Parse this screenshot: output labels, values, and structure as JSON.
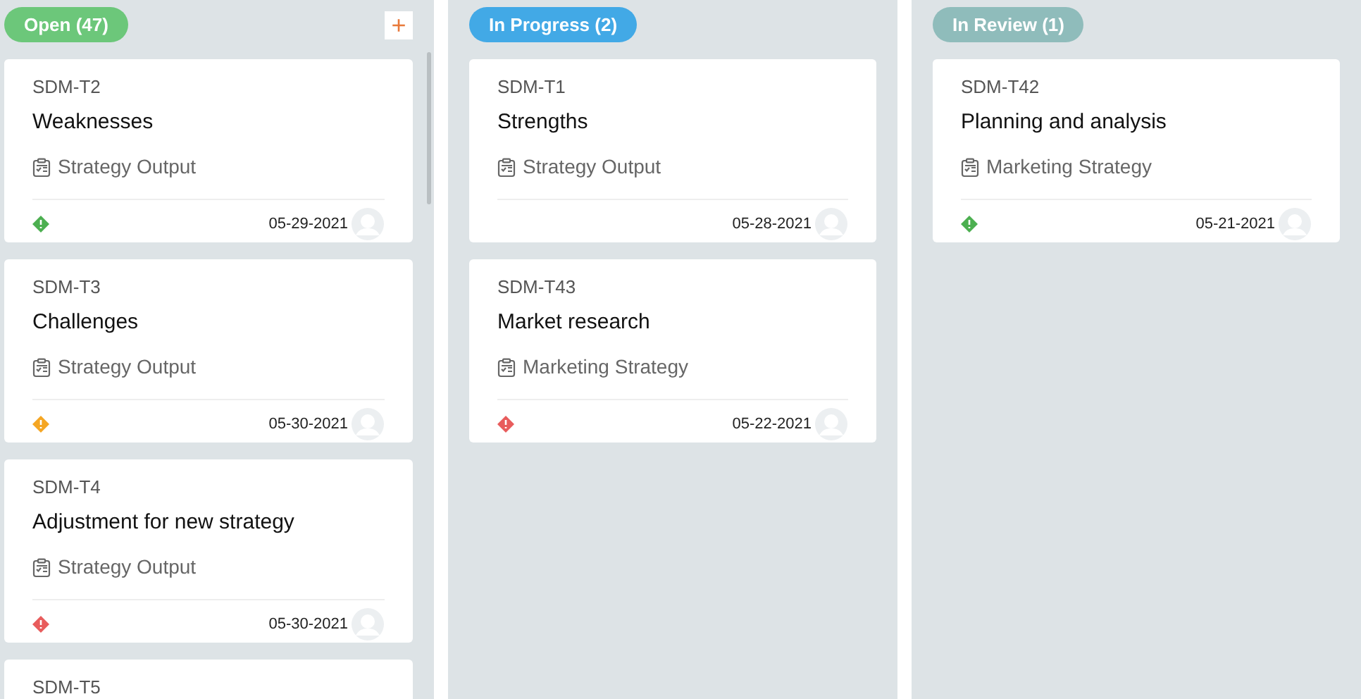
{
  "columns": [
    {
      "title": "Open (47)",
      "color": "#6cc77a",
      "add_button": "+",
      "cards": [
        {
          "id": "SDM-T2",
          "title": "Weaknesses",
          "project": "Strategy Output",
          "color": "#4caf50",
          "date": "05-29-2021"
        },
        {
          "id": "SDM-T3",
          "title": "Challenges",
          "project": "Strategy Output",
          "color": "#f5a623",
          "date": "05-30-2021"
        },
        {
          "id": "SDM-T4",
          "title": "Adjustment for new strategy",
          "project": "Strategy Output",
          "color": "#e85c5c",
          "date": "05-30-2021"
        },
        {
          "id": "SDM-T5"
        }
      ]
    },
    {
      "title": "In Progress (2)",
      "color": "#42a9e6",
      "cards": [
        {
          "id": "SDM-T1",
          "title": "Strengths",
          "project": "Strategy Output",
          "date": "05-28-2021"
        },
        {
          "id": "SDM-T43",
          "title": "Market research",
          "project": "Marketing Strategy",
          "color": "#e85c5c",
          "date": "05-22-2021"
        }
      ]
    },
    {
      "title": "In Review (1)",
      "color": "#8fbcbb",
      "cards": [
        {
          "id": "SDM-T42",
          "title": "Planning and analysis",
          "project": "Marketing Strategy",
          "color": "#4caf50",
          "date": "05-21-2021"
        }
      ]
    }
  ]
}
